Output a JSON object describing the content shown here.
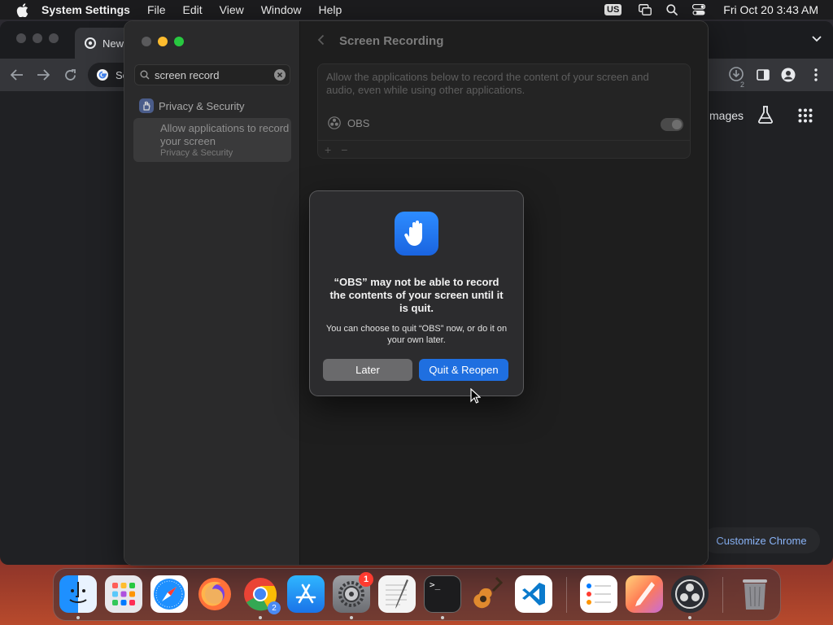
{
  "menubar": {
    "app_name": "System Settings",
    "items": [
      "File",
      "Edit",
      "View",
      "Window",
      "Help"
    ],
    "input_source": "US",
    "clock": "Fri Oct 20  3:43 AM"
  },
  "chrome": {
    "tab_title": "New",
    "omnibox_text": "Se",
    "images_link": "mages",
    "customize_label": "Customize Chrome",
    "download_count": "2"
  },
  "settings": {
    "search_value": "screen record",
    "sidebar_item": "Privacy & Security",
    "result_title": "Allow applications to record your screen",
    "result_subtitle": "Privacy & Security",
    "header_title": "Screen Recording",
    "description": "Allow the applications below to record the content of your screen and audio, even while using other applications.",
    "app_name": "OBS",
    "add_label": "+",
    "remove_label": "−",
    "toggle_on": false
  },
  "alert": {
    "headline": "“OBS” may not be able to record the contents of your screen until it is quit.",
    "body": "You can choose to quit “OBS” now, or do it on your own later.",
    "later_label": "Later",
    "quit_label": "Quit & Reopen"
  },
  "dock": {
    "settings_badge": "1",
    "chrome_badge": "2",
    "terminal_prompt": ">_"
  },
  "colors": {
    "accent_blue": "#1f6fe0",
    "badge_red": "#ff3b30",
    "chrome_link": "#8ab4f8"
  }
}
